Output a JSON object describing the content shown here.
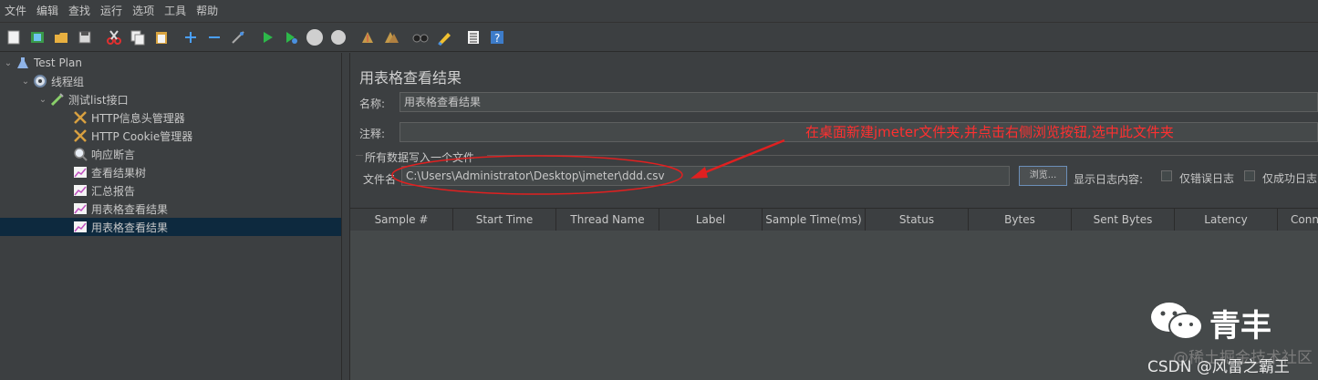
{
  "menu": [
    "文件",
    "编辑",
    "查找",
    "运行",
    "选项",
    "工具",
    "帮助"
  ],
  "toolbar_icons": [
    "new-icon",
    "templates-icon",
    "open-icon",
    "save-icon",
    "cut-icon",
    "copy-icon",
    "paste-icon",
    "expand-icon",
    "collapse-icon",
    "toggle-icon",
    "start-icon",
    "start-no-pause-icon",
    "stop-icon",
    "shutdown-icon",
    "clear-icon",
    "clear-all-icon",
    "search-icon",
    "reset-search-icon",
    "function-helper-icon",
    "help-icon"
  ],
  "tree": {
    "items": [
      {
        "label": "Test Plan",
        "icon": "flask-icon"
      },
      {
        "label": "线程组",
        "icon": "gear-icon"
      },
      {
        "label": "测试list接口",
        "icon": "pipette-icon"
      },
      {
        "label": "HTTP信息头管理器",
        "icon": "tools-icon"
      },
      {
        "label": "HTTP Cookie管理器",
        "icon": "tools-icon"
      },
      {
        "label": "响应断言",
        "icon": "magnifier-icon"
      },
      {
        "label": "查看结果树",
        "icon": "graph-icon"
      },
      {
        "label": "汇总报告",
        "icon": "graph-icon"
      },
      {
        "label": "用表格查看结果",
        "icon": "graph-icon"
      },
      {
        "label": "用表格查看结果",
        "icon": "graph-icon"
      }
    ]
  },
  "panel": {
    "title": "用表格查看结果",
    "name_label": "名称:",
    "name_value": "用表格查看结果",
    "comment_label": "注释:",
    "comment_value": "",
    "file_section": "所有数据写入一个文件",
    "file_label": "文件名",
    "file_value": "C:\\Users\\Administrator\\Desktop\\jmeter\\ddd.csv",
    "browse_label": "浏览...",
    "log_label": "显示日志内容:",
    "errors_only": "仅错误日志",
    "success_only": "仅成功日志"
  },
  "annotation": "在桌面新建jmeter文件夹,并点击右侧浏览按钮,选中此文件夹",
  "table": {
    "columns": [
      "Sample #",
      "Start Time",
      "Thread Name",
      "Label",
      "Sample Time(ms)",
      "Status",
      "Bytes",
      "Sent Bytes",
      "Latency",
      "Conne"
    ]
  },
  "watermark": {
    "name": "青丰",
    "faded": "@稀土掘金技术社区",
    "csdn": "CSDN @风雷之霸王"
  },
  "colors": {
    "annotation": "#ff3030",
    "selected": "#0d293e",
    "background": "#3c3f41"
  }
}
